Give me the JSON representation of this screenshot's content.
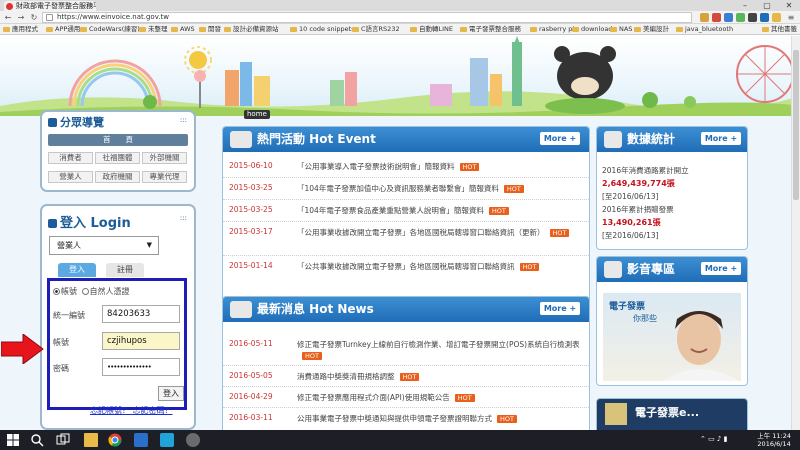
{
  "browser": {
    "tab_title": "財政部電子發票整合服務平台",
    "url": "https://www.einvoice.nat.gov.tw",
    "window_controls": [
      "–",
      "▢",
      "✕"
    ],
    "bookmarks": [
      "應用程式",
      "APP通用",
      "CodeWars(練習)",
      "未整理",
      "AWS",
      "開發",
      "設計必備資源站",
      "10 code snippets",
      "C語言RS232",
      "自動轉LINE",
      "電子發票整合服務",
      "rasberry pi",
      "download",
      "NAS",
      "美編設計",
      "java_bluetooth",
      "其他書籤"
    ]
  },
  "page": {
    "home_tag": "home",
    "nav_panel": {
      "title": "分眾導覽",
      "home_button": "首　　頁",
      "buttons": [
        "消費者",
        "社福團體",
        "外部機關",
        "營業人",
        "政府機關",
        "專業代理"
      ]
    },
    "login_panel": {
      "title": "登入 Login",
      "select_value": "營業人",
      "tab_login": "登入",
      "tab_register": "註冊",
      "radio_account": "帳號",
      "radio_cert": "自然人憑證",
      "label_tax_id": "統一編號",
      "value_tax_id": "84203633",
      "label_account": "帳號",
      "value_account": "czjihupos",
      "label_password": "密碼",
      "value_password": "••••••••••••••",
      "login_button": "登入",
      "forgot_link": "忘記帳號？ 忘記密碼？"
    },
    "hot_event": {
      "title": "熱門活動 Hot Event",
      "more": "More",
      "items": [
        {
          "date": "2015-06-10",
          "text": "「公用事業導入電子發票技術說明會」簡報資料",
          "hot": "HOT"
        },
        {
          "date": "2015-03-25",
          "text": "「104年電子發票加值中心及資訊服務業者聯繫會」簡報資料",
          "hot": "HOT"
        },
        {
          "date": "2015-03-25",
          "text": "「104年電子發票食品產業重點營業人說明會」簡報資料",
          "hot": "HOT"
        },
        {
          "date": "2015-03-17",
          "text": "「公用事業收據改開立電子發票」各地區國稅局轄導窗口聯絡資訊（更新）",
          "hot": "HOT"
        },
        {
          "date": "2015-01-14",
          "text": "「公共事業收據改開立電子發票」各地區國稅局轄導窗口聯絡資訊",
          "hot": "HOT"
        }
      ]
    },
    "news": {
      "title": "最新消息 Hot News",
      "more": "More",
      "items": [
        {
          "date": "2016-05-11",
          "text": "修正電子發票Turnkey上線前自行檢測作業、增訂電子發票開立(POS)系統自行檢測表",
          "hot": "HOT"
        },
        {
          "date": "2016-05-05",
          "text": "消費通路中獎獎清冊規格調整",
          "hot": "HOT"
        },
        {
          "date": "2016-04-29",
          "text": "修正電子發票應用程式介面(API)使用規範公告",
          "hot": "HOT"
        },
        {
          "date": "2016-03-11",
          "text": "公用事業電子發票中獎通知與提供申領電子發票證明聯方式",
          "hot": "HOT"
        }
      ]
    },
    "stats": {
      "title": "數據統計",
      "more": "More",
      "line1": "2016年消費通路累計開立",
      "num1": "2,649,439,774張",
      "date1": "[至2016/06/13]",
      "line2": "2016年累計捐贈發票",
      "num2": "13,490,261張",
      "date2": "[至2016/06/13]"
    },
    "video": {
      "title": "影音專區",
      "more": "More",
      "caption": "電子發票",
      "caption2": "你那些",
      "bottom_caption": "電子發票e..."
    }
  },
  "taskbar": {
    "time": "上午 11:24",
    "date": "2016/6/14"
  }
}
